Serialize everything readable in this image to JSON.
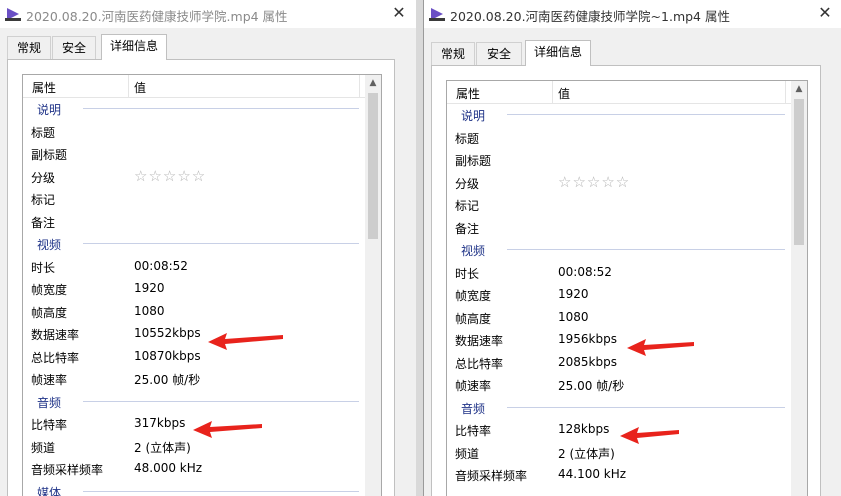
{
  "left": {
    "title": "2020.08.20.河南医药健康技师学院.mp4 属性",
    "close": "✕",
    "tabs": [
      {
        "label": "常规"
      },
      {
        "label": "安全"
      },
      {
        "label": "详细信息"
      }
    ],
    "col_property": "属性",
    "col_value": "值",
    "groups": {
      "desc": "说明",
      "video": "视频",
      "audio": "音频",
      "media": "媒体"
    },
    "desc_rows": [
      {
        "label": "标题",
        "value": ""
      },
      {
        "label": "副标题",
        "value": ""
      },
      {
        "label": "分级",
        "value": "☆☆☆☆☆"
      },
      {
        "label": "标记",
        "value": ""
      },
      {
        "label": "备注",
        "value": ""
      }
    ],
    "video_rows": [
      {
        "label": "时长",
        "value": "00:08:52"
      },
      {
        "label": "帧宽度",
        "value": "1920"
      },
      {
        "label": "帧高度",
        "value": "1080"
      },
      {
        "label": "数据速率",
        "value": "10552kbps"
      },
      {
        "label": "总比特率",
        "value": "10870kbps"
      },
      {
        "label": "帧速率",
        "value": "25.00 帧/秒"
      }
    ],
    "audio_rows": [
      {
        "label": "比特率",
        "value": "317kbps"
      },
      {
        "label": "频道",
        "value": "2 (立体声)"
      },
      {
        "label": "音频采样频率",
        "value": "48.000 kHz"
      }
    ]
  },
  "right": {
    "title": "2020.08.20.河南医药健康技师学院~1.mp4 属性",
    "close": "✕",
    "tabs": [
      {
        "label": "常规"
      },
      {
        "label": "安全"
      },
      {
        "label": "详细信息"
      }
    ],
    "col_property": "属性",
    "col_value": "值",
    "groups": {
      "desc": "说明",
      "video": "视频",
      "audio": "音频"
    },
    "desc_rows": [
      {
        "label": "标题",
        "value": ""
      },
      {
        "label": "副标题",
        "value": ""
      },
      {
        "label": "分级",
        "value": "☆☆☆☆☆"
      },
      {
        "label": "标记",
        "value": ""
      },
      {
        "label": "备注",
        "value": ""
      }
    ],
    "video_rows": [
      {
        "label": "时长",
        "value": "00:08:52"
      },
      {
        "label": "帧宽度",
        "value": "1920"
      },
      {
        "label": "帧高度",
        "value": "1080"
      },
      {
        "label": "数据速率",
        "value": "1956kbps"
      },
      {
        "label": "总比特率",
        "value": "2085kbps"
      },
      {
        "label": "帧速率",
        "value": "25.00 帧/秒"
      }
    ],
    "audio_rows": [
      {
        "label": "比特率",
        "value": "128kbps"
      },
      {
        "label": "频道",
        "value": "2 (立体声)"
      },
      {
        "label": "音频采样频率",
        "value": "44.100 kHz"
      }
    ]
  },
  "colors": {
    "arrow": "#e8231c",
    "group_text": "#1e3287"
  },
  "icons": {
    "app": "video-file-icon",
    "close": "close-icon",
    "arrow": "red-arrow-annotation"
  }
}
